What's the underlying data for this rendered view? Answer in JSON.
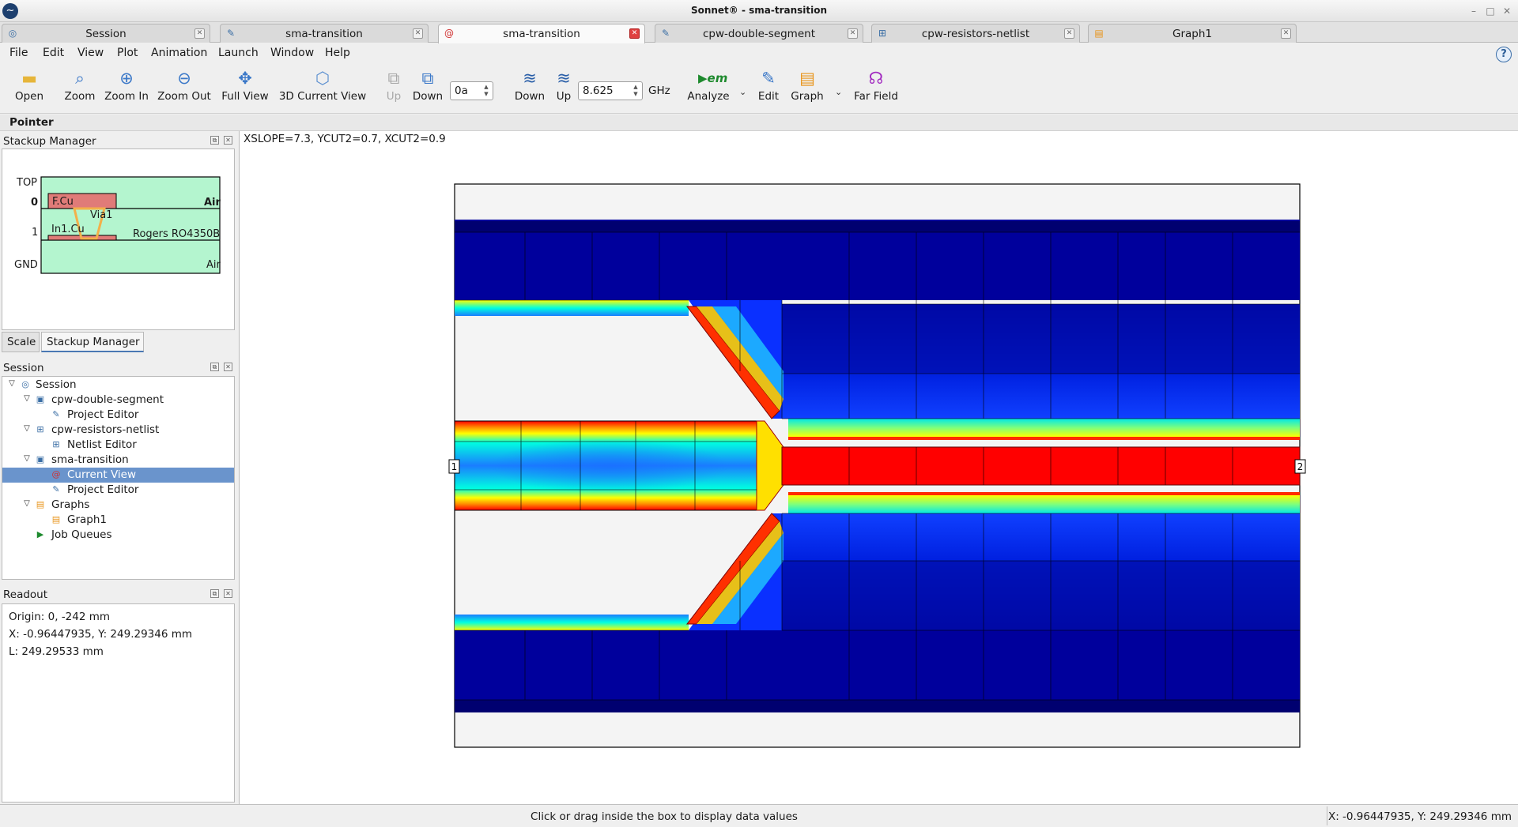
{
  "window": {
    "title": "Sonnet® - sma-transition"
  },
  "tabs": [
    {
      "label": "Session",
      "icon": "session-icon"
    },
    {
      "label": "sma-transition",
      "icon": "project-editor-icon"
    },
    {
      "label": "sma-transition",
      "icon": "current-view-icon",
      "active": true
    },
    {
      "label": "cpw-double-segment",
      "icon": "project-editor-icon"
    },
    {
      "label": "cpw-resistors-netlist",
      "icon": "netlist-icon"
    },
    {
      "label": "Graph1",
      "icon": "graph-icon"
    }
  ],
  "menu": [
    "File",
    "Edit",
    "View",
    "Plot",
    "Animation",
    "Launch",
    "Window",
    "Help"
  ],
  "toolbar": {
    "open": "Open",
    "zoom": "Zoom",
    "zoom_in": "Zoom In",
    "zoom_out": "Zoom Out",
    "full_view": "Full View",
    "current_view_3d": "3D Current View",
    "level_up": "Up",
    "level_down": "Down",
    "level_value": "0a",
    "freq_down": "Down",
    "freq_up": "Up",
    "freq_value": "8.625",
    "freq_unit": "GHz",
    "analyze": "Analyze",
    "edit": "Edit",
    "graph": "Graph",
    "far_field": "Far Field"
  },
  "pointer_bar": {
    "label": "Pointer"
  },
  "stackup": {
    "title": "Stackup Manager",
    "levels": [
      "TOP",
      "0",
      "1",
      "GND"
    ],
    "layers": {
      "fcu": "F.Cu",
      "in1cu": "In1.Cu",
      "via": "Via1",
      "dielectric": "Rogers RO4350B",
      "air_top": "Air",
      "air_bottom": "Air"
    },
    "colors": {
      "dielectric": "#b4f5cf",
      "metal": "#e07b78",
      "via": "#f3b04a"
    }
  },
  "bottom_tabs": {
    "scale": "Scale",
    "stackup": "Stackup Manager"
  },
  "session": {
    "title": "Session",
    "tree": [
      {
        "label": "Session",
        "level": 0,
        "expanded": true,
        "icon": "session-icon"
      },
      {
        "label": "cpw-double-segment",
        "level": 1,
        "expanded": true,
        "icon": "project-icon"
      },
      {
        "label": "Project Editor",
        "level": 2,
        "icon": "project-editor-icon"
      },
      {
        "label": "cpw-resistors-netlist",
        "level": 1,
        "expanded": true,
        "icon": "netlist-icon"
      },
      {
        "label": "Netlist Editor",
        "level": 2,
        "icon": "netlist-icon"
      },
      {
        "label": "sma-transition",
        "level": 1,
        "expanded": true,
        "icon": "project-icon"
      },
      {
        "label": "Current View",
        "level": 2,
        "icon": "current-view-icon",
        "selected": true
      },
      {
        "label": "Project Editor",
        "level": 2,
        "icon": "project-editor-icon"
      },
      {
        "label": "Graphs",
        "level": 1,
        "expanded": true,
        "icon": "graph-icon"
      },
      {
        "label": "Graph1",
        "level": 2,
        "icon": "graph-icon"
      },
      {
        "label": "Job Queues",
        "level": 1,
        "icon": "job-queue-icon"
      }
    ]
  },
  "readout": {
    "title": "Readout",
    "origin": "Origin: 0, -242 mm",
    "xy": "X: -0.96447935, Y: 249.29346 mm",
    "length": "L: 249.29533 mm"
  },
  "view": {
    "params": "XSLOPE=7.3, YCUT2=0.7, XCUT2=0.9",
    "port_left": "1",
    "port_right": "2",
    "colormap": [
      "#00005a",
      "#0000b4",
      "#0a3cff",
      "#00b4ff",
      "#00ffe0",
      "#7dff7d",
      "#ffff00",
      "#ff8c00",
      "#ff0000"
    ]
  },
  "status": {
    "message": "Click or drag inside the box to display data values",
    "coords": "X: -0.96447935, Y: 249.29346 mm"
  }
}
